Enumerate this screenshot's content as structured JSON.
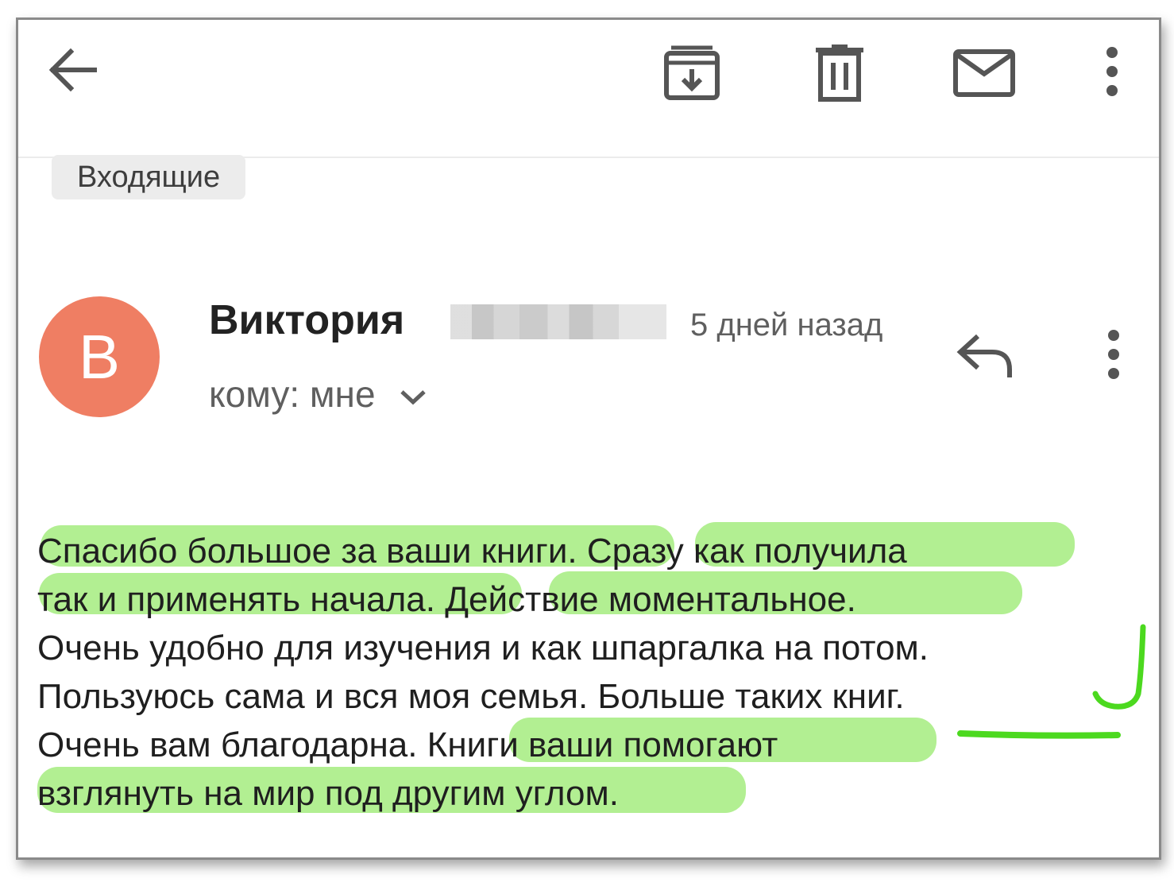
{
  "toolbar": {
    "back_icon": "arrow-left-icon",
    "archive_icon": "archive-icon",
    "delete_icon": "trash-icon",
    "mark_unread_icon": "envelope-icon",
    "more_icon": "more-vertical-icon"
  },
  "label": "Входящие",
  "message": {
    "avatar_letter": "В",
    "avatar_color": "#ef7e63",
    "sender_name": "Виктория",
    "sender_surname_redacted": true,
    "time": "5 дней назад",
    "recipient": "кому: мне",
    "reply_icon": "reply-icon",
    "more_icon": "more-vertical-icon",
    "body_lines": [
      "Спасибо большое за ваши книги. Сразу как получила",
      "так и применять начала. Действие моментальное.",
      "Очень удобно для изучения и как шпаргалка на потом.",
      "Пользуюсь сама и вся моя семья. Больше таких книг.",
      "Очень вам благодарна. Книги ваши помогают",
      "взглянуть на мир под другим углом."
    ]
  },
  "highlight_color": "#98ea6d",
  "annotation_color": "#4cd91f"
}
